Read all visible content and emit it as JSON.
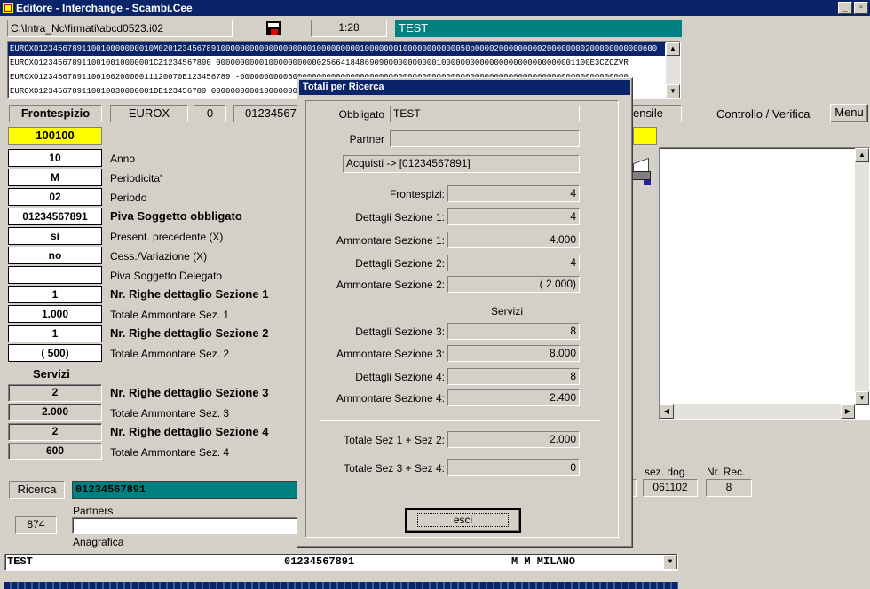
{
  "window": {
    "title": "Editore - Interchange - Scambi.Cee"
  },
  "toolbar": {
    "path": "C:\\Intra_Nc\\firmati\\abcd0523.i02",
    "time": "1:28",
    "env": "TEST"
  },
  "records": [
    "EUROX0123456789110010000000010M02012345678910000000000000000000100000000010000000100000000000050p00002000000000200000000200000000000600",
    "EUROX0123456789110010010000001CZ1234567890      000000000010000000000025664184869090000000000010000000000000000000000000001100E3CZCZVR",
    "EUROX0123456789110010020000011120070E123456789     -000000000050000000000000000000000000000000000000000000000000000000000000000000000",
    "EUROX0123456789110010030000001DE123456789      000000000010000000000000000000000000000000000000000000000000000000000000000000000000"
  ],
  "header": {
    "tab": "Frontespizio",
    "eurox": "EUROX",
    "zero": "0",
    "piva": "01234567891",
    "ensile": "ensile",
    "controllo": "Controllo / Verifica",
    "menu": "Menu"
  },
  "code_field": "100100",
  "form": [
    {
      "value": "10",
      "label": "Anno",
      "bold": false
    },
    {
      "value": "M",
      "label": "Periodicita'",
      "bold": false
    },
    {
      "value": "02",
      "label": "Periodo",
      "bold": false
    },
    {
      "value": "01234567891",
      "label": "Piva Soggetto obbligato",
      "bold": true
    },
    {
      "value": "si",
      "label": "Present. precedente (X)",
      "bold": false
    },
    {
      "value": "no",
      "label": "Cess./Variazione (X)",
      "bold": false
    },
    {
      "value": "",
      "label": "Piva Soggetto Delegato",
      "bold": false
    },
    {
      "value": "1",
      "label": "Nr. Righe dettaglio Sezione 1",
      "bold": true
    },
    {
      "value": "1.000",
      "label": "Totale Ammontare Sez. 1",
      "bold": false
    },
    {
      "value": "1",
      "label": "Nr. Righe dettaglio Sezione 2",
      "bold": true
    },
    {
      "value": "( 500)",
      "label": "Totale Ammontare Sez. 2",
      "bold": false
    }
  ],
  "servizi_label": "Servizi",
  "servizi_form": [
    {
      "value": "2",
      "label": "Nr. Righe dettaglio Sezione 3",
      "bold": true
    },
    {
      "value": "2.000",
      "label": "Totale Ammontare Sez. 3",
      "bold": false
    },
    {
      "value": "2",
      "label": "Nr. Righe dettaglio Sezione 4",
      "bold": true
    },
    {
      "value": "600",
      "label": "Totale Ammontare Sez. 4",
      "bold": false
    }
  ],
  "ricerca": {
    "label": "Ricerca",
    "value": "01234567891"
  },
  "partners": {
    "count": "874",
    "label": "Partners",
    "anagrafica": "Anagrafica"
  },
  "sez_dog": {
    "label": "sez. dog.",
    "value": "061102"
  },
  "nr_rec": {
    "label": "Nr. Rec.",
    "value": "8"
  },
  "bottom_select": {
    "name": "TEST",
    "piva": "01234567891",
    "city": "M M MILANO"
  },
  "dialog": {
    "title": "Totali per Ricerca",
    "obbligato_label": "Obbligato",
    "obbligato": "TEST",
    "partner_label": "Partner",
    "partner": "",
    "acquisti": "Acquisti -> [01234567891]",
    "rows1": [
      {
        "label": "Frontespizi:",
        "value": "4"
      },
      {
        "label": "Dettagli Sezione 1:",
        "value": "4"
      },
      {
        "label": "Ammontare Sezione 1:",
        "value": "4.000"
      },
      {
        "label": "Dettagli Sezione 2:",
        "value": "4"
      },
      {
        "label": "Ammontare Sezione 2:",
        "value": "( 2.000)"
      }
    ],
    "servizi": "Servizi",
    "rows2": [
      {
        "label": "Dettagli Sezione 3:",
        "value": "8"
      },
      {
        "label": "Ammontare Sezione 3:",
        "value": "8.000"
      },
      {
        "label": "Dettagli Sezione 4:",
        "value": "8"
      },
      {
        "label": "Ammontare Sezione 4:",
        "value": "2.400"
      }
    ],
    "tot12_label": "Totale Sez 1 + Sez 2:",
    "tot12": "2.000",
    "tot34_label": "Totale Sez 3 + Sez 4:",
    "tot34": "0",
    "esci": "esci"
  }
}
